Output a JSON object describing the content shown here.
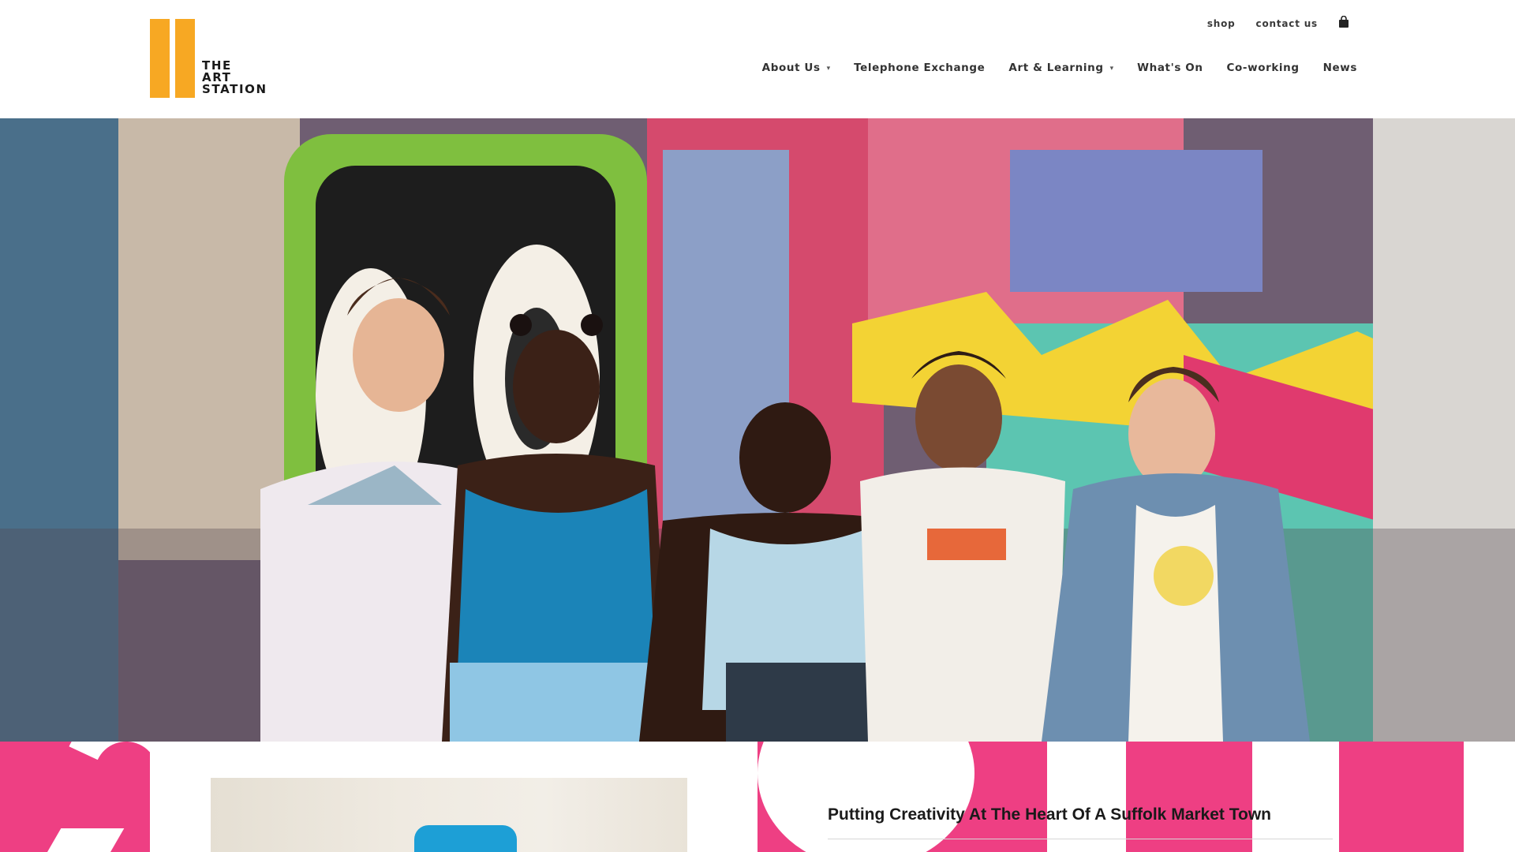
{
  "colors": {
    "brand_orange": "#f7a823",
    "brand_pink": "#ee3f83",
    "nav_text": "#333333",
    "slider_dot": "#ffffff"
  },
  "logo": {
    "lines": [
      "THE",
      "ART",
      "STATION"
    ]
  },
  "utility_nav": {
    "shop": "shop",
    "contact": "contact us",
    "cart_icon": "shopping-bag-icon"
  },
  "main_nav": {
    "items": [
      {
        "label": "About Us",
        "has_dropdown": true
      },
      {
        "label": "Telephone Exchange",
        "has_dropdown": false
      },
      {
        "label": "Art & Learning",
        "has_dropdown": true
      },
      {
        "label": "What's On",
        "has_dropdown": false
      },
      {
        "label": "Co-working",
        "has_dropdown": false
      },
      {
        "label": "News",
        "has_dropdown": false
      }
    ],
    "dropdown_caret": "▾"
  },
  "hero": {
    "slide_count": 6
  },
  "intro": {
    "title": "Putting Creativity At The Heart Of A Suffolk Market Town"
  }
}
